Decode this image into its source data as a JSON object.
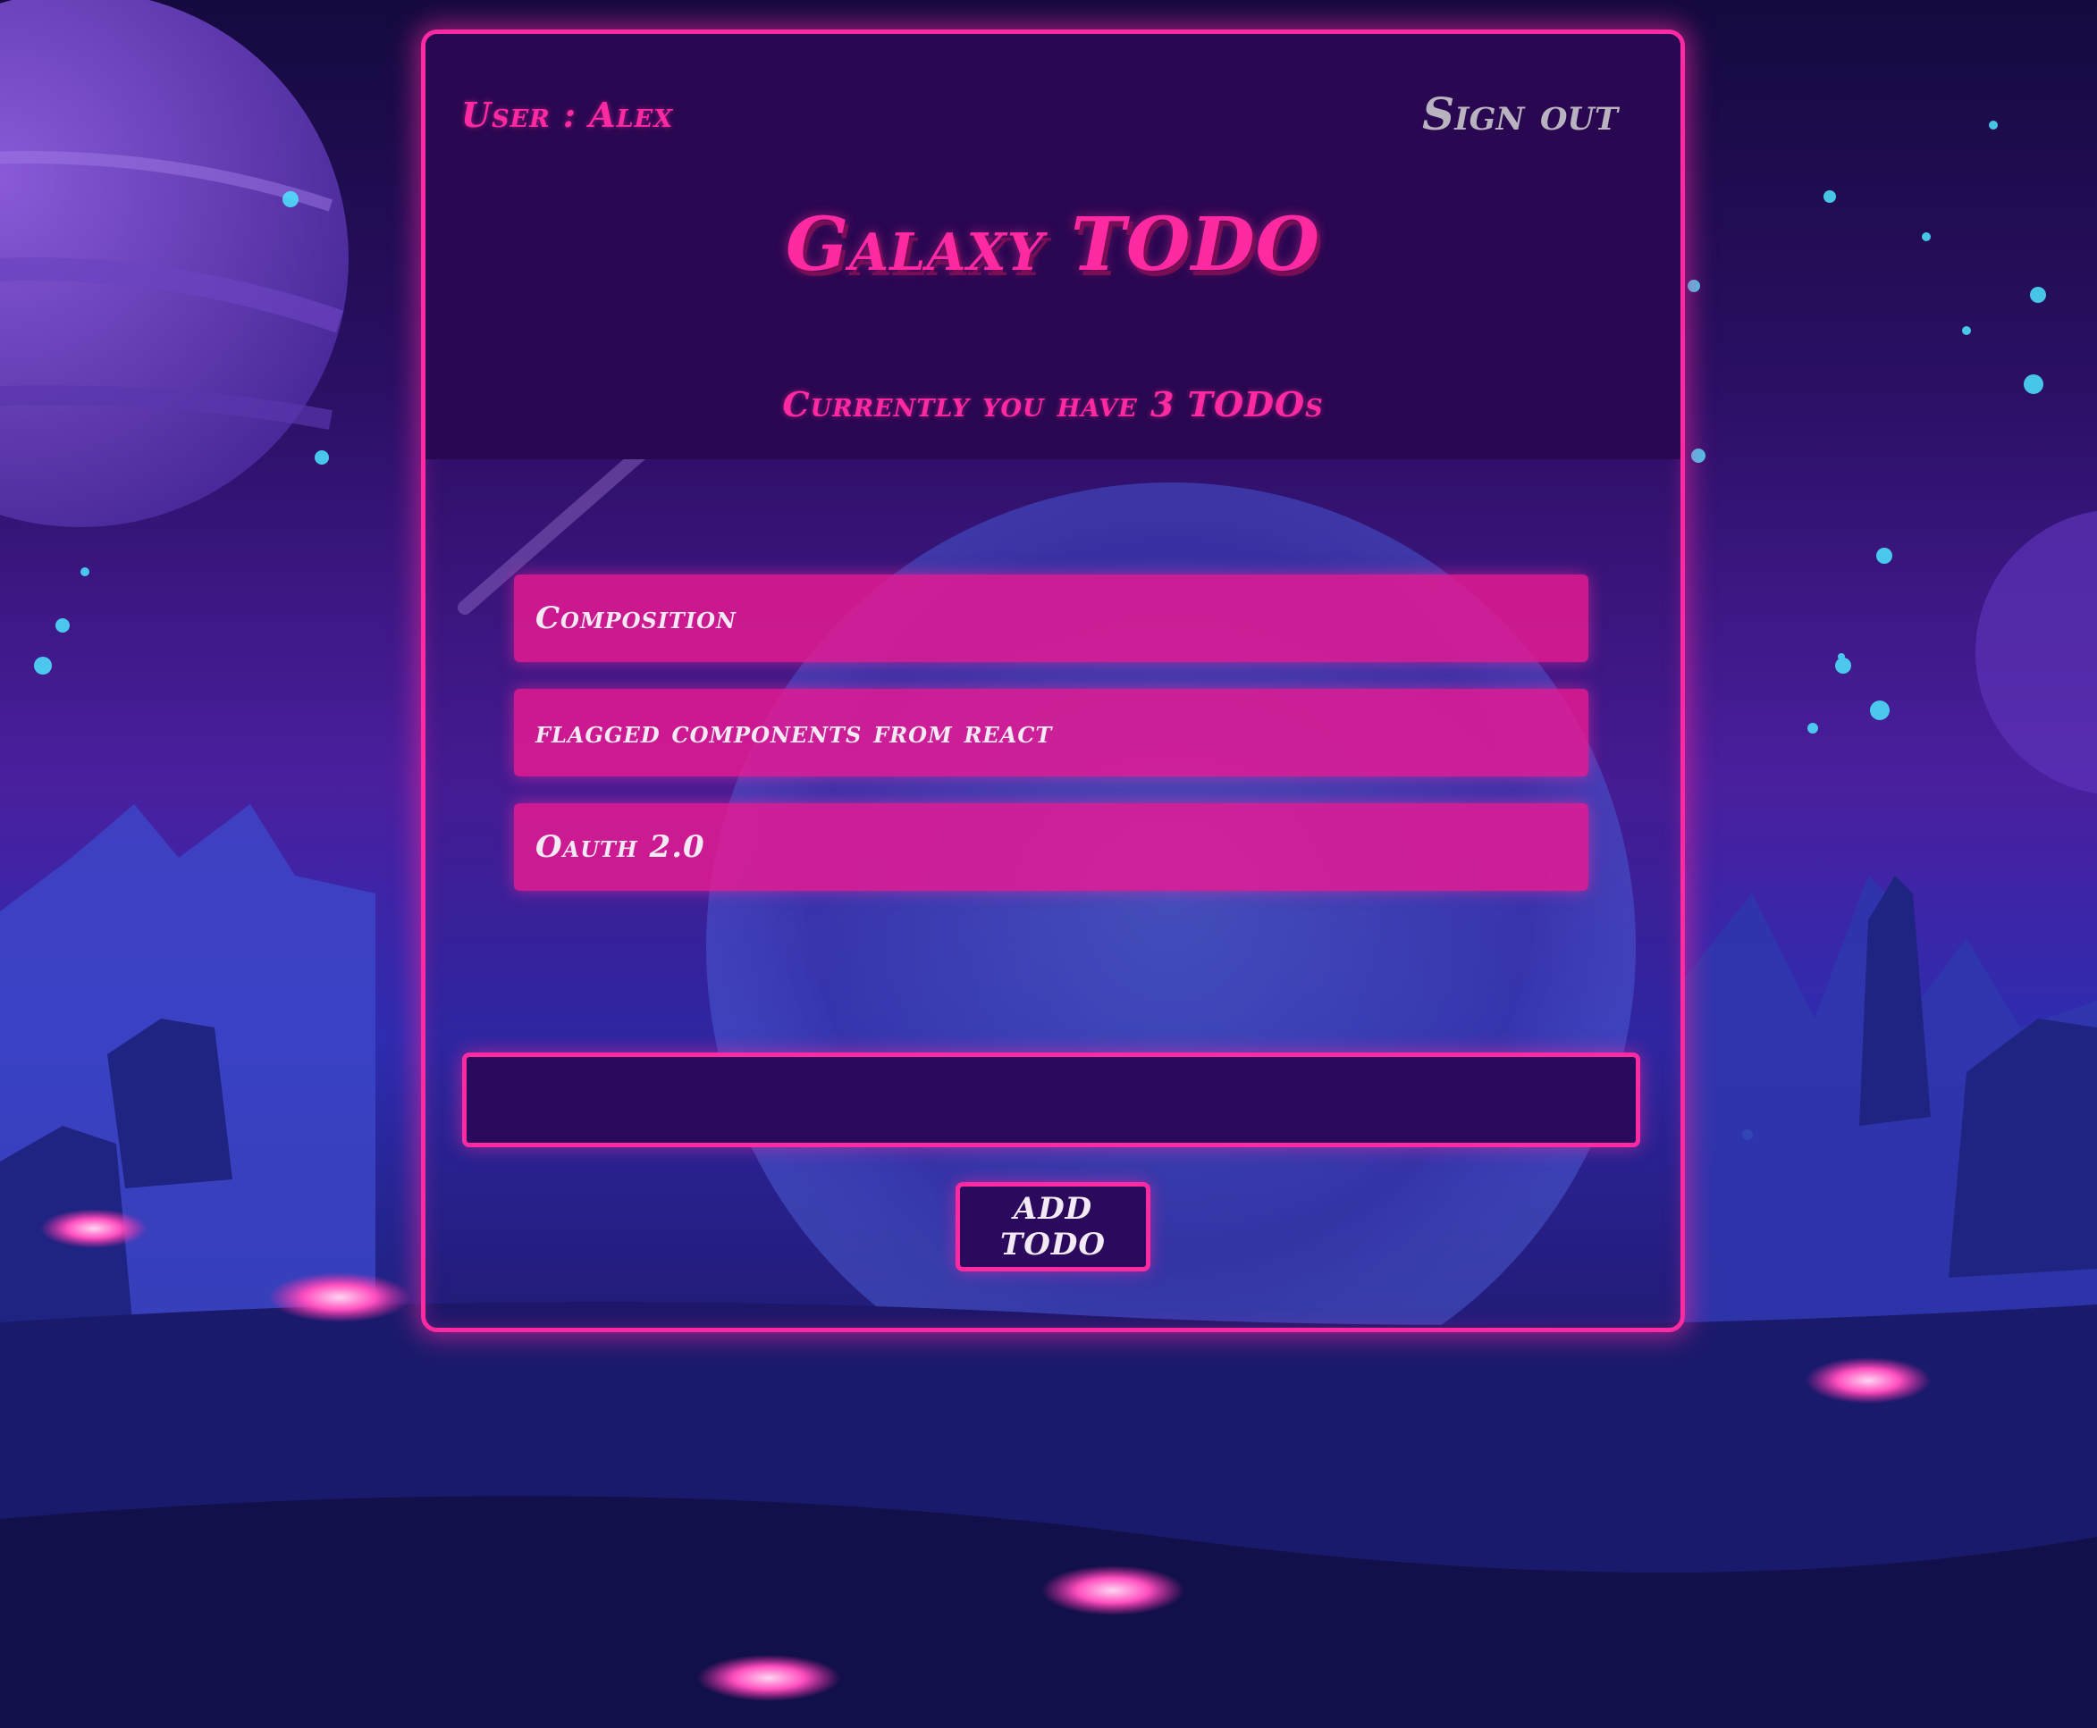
{
  "header": {
    "user_label": "User : Alex",
    "signout_label": "Sign out",
    "title": "Galaxy TODO",
    "subtitle": "Currently you have 3 TODOs"
  },
  "todos": [
    {
      "text": "Composition"
    },
    {
      "text": "flagged components from react"
    },
    {
      "text": "Oauth 2.0"
    }
  ],
  "new_todo": {
    "value": "",
    "placeholder": ""
  },
  "add_button_label": "ADD TODO",
  "colors": {
    "accent": "#ff2aa1",
    "header_bg": "#2a0751",
    "todo_bg": "#ec1a92",
    "text_light": "#f4eaf6",
    "signout_gray": "#b9b2bf"
  }
}
